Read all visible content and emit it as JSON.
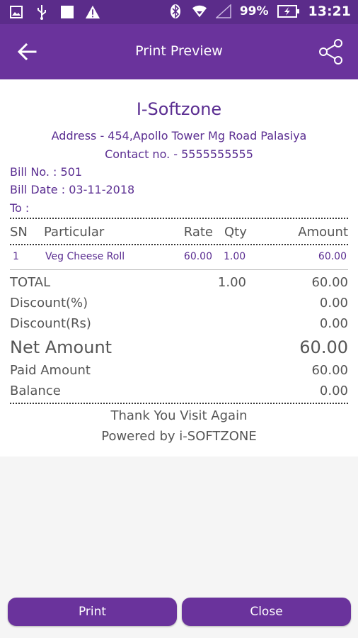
{
  "status_bar": {
    "battery": "99%",
    "time": "13:21"
  },
  "toolbar": {
    "title": "Print Preview"
  },
  "receipt": {
    "company": "I-Softzone",
    "address": "Address - 454,Apollo Tower Mg Road Palasiya",
    "contact": "Contact no. - 5555555555",
    "bill_no": "Bill No.  : 501",
    "bill_date": "Bill Date : 03-11-2018",
    "to": "To :",
    "headers": {
      "sn": "SN",
      "particular": "Particular",
      "rate": "Rate",
      "qty": "Qty",
      "amount": "Amount"
    },
    "items": [
      {
        "sn": "1",
        "particular": "Veg Cheese Roll",
        "rate": "60.00",
        "qty": "1.00",
        "amount": "60.00"
      }
    ],
    "total": {
      "label": "TOTAL",
      "qty": "1.00",
      "amount": "60.00"
    },
    "discount_pct": {
      "label": "Discount(%)",
      "value": "0.00"
    },
    "discount_rs": {
      "label": "Discount(Rs)",
      "value": "0.00"
    },
    "net_amount": {
      "label": "Net Amount",
      "value": "60.00"
    },
    "paid_amount": {
      "label": "Paid Amount",
      "value": "60.00"
    },
    "balance": {
      "label": "Balance",
      "value": "0.00"
    },
    "thank_you": "Thank You Visit Again",
    "powered_by": "Powered by i-SOFTZONE"
  },
  "buttons": {
    "print": "Print",
    "close": "Close"
  },
  "colors": {
    "status_bar": "#5b2c8a",
    "toolbar": "#6a339c",
    "accent_text": "#5a2d91"
  }
}
